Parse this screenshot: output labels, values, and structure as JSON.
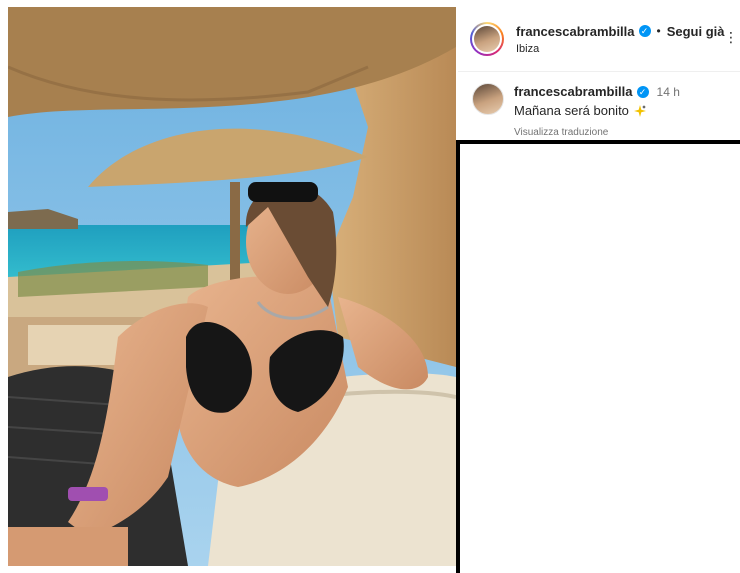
{
  "post": {
    "image_alt": "Woman in black bikini relaxing under straw umbrellas on a beach",
    "username": "francescabrambilla",
    "follow_label": "Segui già",
    "dot": "•",
    "location": "Ibiza"
  },
  "caption": {
    "username": "francescabrambilla",
    "time": "14 h",
    "text": "Mañana será bonito",
    "translate_label": "Visualizza traduzione"
  },
  "icons": {
    "verified": "verified-badge-icon",
    "more": "more-options-icon",
    "sparkle": "sparkle-emoji-icon"
  },
  "colors": {
    "verified": "#0095f6",
    "secondary_text": "#737373"
  }
}
